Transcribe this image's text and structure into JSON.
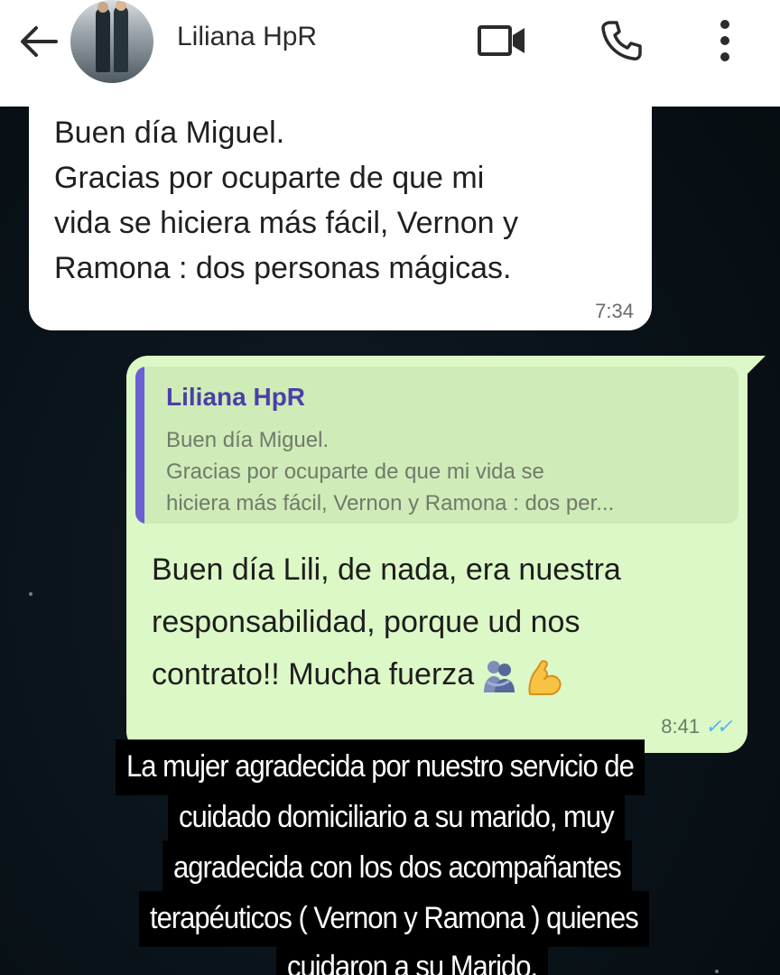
{
  "header": {
    "contact_name": "Liliana HpR",
    "icons": [
      "back-arrow-icon",
      "video-call-icon",
      "phone-icon",
      "more-vert-icon"
    ]
  },
  "messages": {
    "incoming": {
      "text": "Buen día Miguel.\nGracias por ocuparte de que mi\nvida se hiciera más fácil, Vernon y\nRamona : dos personas mágicas.",
      "time": "7:34"
    },
    "outgoing": {
      "quote_author": "Liliana HpR",
      "quote_text": "Buen día Miguel.\nGracias por ocuparte de que mi vida se\nhiciera más fácil, Vernon y Ramona : dos per...",
      "text": "Buen día Lili, de nada, era nuestra\nresponsabilidad, porque ud nos\ncontrato!! Mucha fuerza",
      "emojis": [
        "people-hugging-emoji",
        "flexed-biceps-emoji"
      ],
      "time": "8:41",
      "status": "read-double-check-icon"
    }
  },
  "caption": {
    "lines": [
      "La  mujer agradecida por nuestro servicio de",
      "cuidado domiciliario a su marido, muy",
      "agradecida con los dos acompañantes",
      "terapéuticos ( Vernon y Ramona ) quienes",
      "cuidaron a su Marido."
    ]
  },
  "colors": {
    "header_bg": "#ffffff",
    "incoming_bubble": "#ffffff",
    "outgoing_bubble": "#dcf8c6",
    "quote_bar": "#6a5fd3",
    "quote_author": "#4b3fa8",
    "read_ticks": "#4fb6ec",
    "chat_bg": "#091218",
    "caption_bg": "#000000",
    "caption_text": "#ffffff"
  }
}
